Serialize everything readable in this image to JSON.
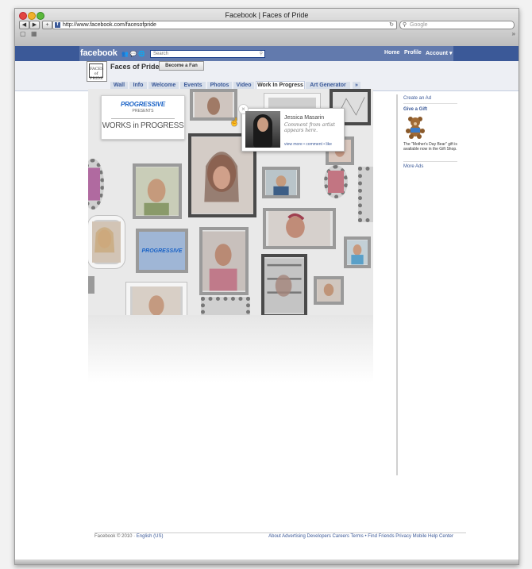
{
  "browser": {
    "window_title": "Facebook | Faces of Pride",
    "url": "http://www.facebook.com/facesofpride",
    "search_placeholder": "Google",
    "back": "◀",
    "forward": "▶",
    "add": "+",
    "reload": "↻"
  },
  "fb": {
    "logo": "facebook",
    "search_placeholder": "Search",
    "nav": [
      "Home",
      "Profile",
      "Account ▾"
    ]
  },
  "page": {
    "name": "Faces of Pride",
    "avatar_text": "FACES of PRIDE",
    "fan_button": "Become a Fan",
    "tabs": [
      "Wall",
      "Info",
      "Welcome",
      "Events",
      "Photos",
      "Video",
      "Work In Progress",
      "Art Generator",
      "»"
    ],
    "active_tab_index": 6
  },
  "app": {
    "brand": "PROGRESSIVE",
    "presents": "PRESENTS",
    "title": "WORKS in PROGRESS",
    "frame_label": "PROGRESSIVE",
    "popup": {
      "close": "×",
      "name": "Jessica Masarin",
      "comment": "Comment from artist appears here.",
      "links": "view more • comment • like"
    }
  },
  "sidebar": {
    "create_ad": "Create an Ad",
    "gift_heading": "Give a Gift",
    "gift_text": "The \"Mother's Day Bear\" gift is available now in the Gift Shop.",
    "more_ads": "More Ads"
  },
  "footer": {
    "copyright": "Facebook © 2010 ·",
    "language": "English (US)",
    "links": [
      "About",
      "Advertising",
      "Developers",
      "Careers",
      "Terms",
      "•",
      "Find Friends",
      "Privacy",
      "Mobile",
      "Help Center"
    ]
  },
  "colors": {
    "fb_blue": "#3b5998",
    "fb_blue_light": "#627aad",
    "progressive_blue": "#1b63c6"
  }
}
